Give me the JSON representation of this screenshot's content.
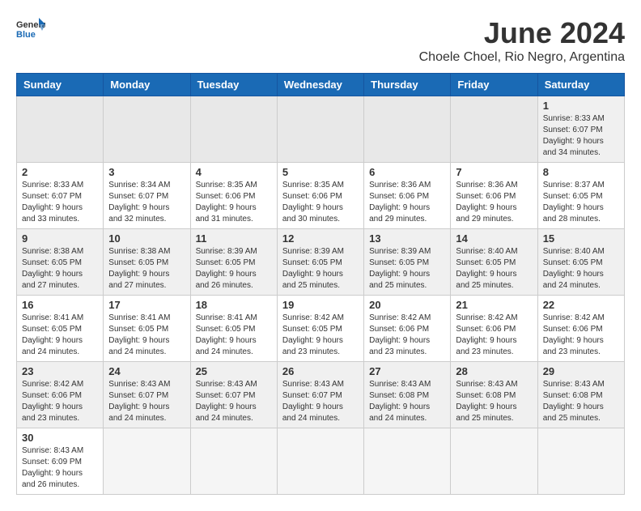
{
  "header": {
    "logo_general": "General",
    "logo_blue": "Blue",
    "title": "June 2024",
    "subtitle": "Choele Choel, Rio Negro, Argentina"
  },
  "weekdays": [
    "Sunday",
    "Monday",
    "Tuesday",
    "Wednesday",
    "Thursday",
    "Friday",
    "Saturday"
  ],
  "weeks": [
    [
      {
        "day": "",
        "info": "",
        "empty": true
      },
      {
        "day": "",
        "info": "",
        "empty": true
      },
      {
        "day": "",
        "info": "",
        "empty": true
      },
      {
        "day": "",
        "info": "",
        "empty": true
      },
      {
        "day": "",
        "info": "",
        "empty": true
      },
      {
        "day": "",
        "info": "",
        "empty": true
      },
      {
        "day": "1",
        "info": "Sunrise: 8:33 AM\nSunset: 6:07 PM\nDaylight: 9 hours\nand 34 minutes."
      }
    ],
    [
      {
        "day": "2",
        "info": "Sunrise: 8:33 AM\nSunset: 6:07 PM\nDaylight: 9 hours\nand 33 minutes."
      },
      {
        "day": "3",
        "info": "Sunrise: 8:34 AM\nSunset: 6:07 PM\nDaylight: 9 hours\nand 32 minutes."
      },
      {
        "day": "4",
        "info": "Sunrise: 8:35 AM\nSunset: 6:06 PM\nDaylight: 9 hours\nand 31 minutes."
      },
      {
        "day": "5",
        "info": "Sunrise: 8:35 AM\nSunset: 6:06 PM\nDaylight: 9 hours\nand 30 minutes."
      },
      {
        "day": "6",
        "info": "Sunrise: 8:36 AM\nSunset: 6:06 PM\nDaylight: 9 hours\nand 29 minutes."
      },
      {
        "day": "7",
        "info": "Sunrise: 8:36 AM\nSunset: 6:06 PM\nDaylight: 9 hours\nand 29 minutes."
      },
      {
        "day": "8",
        "info": "Sunrise: 8:37 AM\nSunset: 6:05 PM\nDaylight: 9 hours\nand 28 minutes."
      }
    ],
    [
      {
        "day": "9",
        "info": "Sunrise: 8:38 AM\nSunset: 6:05 PM\nDaylight: 9 hours\nand 27 minutes."
      },
      {
        "day": "10",
        "info": "Sunrise: 8:38 AM\nSunset: 6:05 PM\nDaylight: 9 hours\nand 27 minutes."
      },
      {
        "day": "11",
        "info": "Sunrise: 8:39 AM\nSunset: 6:05 PM\nDaylight: 9 hours\nand 26 minutes."
      },
      {
        "day": "12",
        "info": "Sunrise: 8:39 AM\nSunset: 6:05 PM\nDaylight: 9 hours\nand 25 minutes."
      },
      {
        "day": "13",
        "info": "Sunrise: 8:39 AM\nSunset: 6:05 PM\nDaylight: 9 hours\nand 25 minutes."
      },
      {
        "day": "14",
        "info": "Sunrise: 8:40 AM\nSunset: 6:05 PM\nDaylight: 9 hours\nand 25 minutes."
      },
      {
        "day": "15",
        "info": "Sunrise: 8:40 AM\nSunset: 6:05 PM\nDaylight: 9 hours\nand 24 minutes."
      }
    ],
    [
      {
        "day": "16",
        "info": "Sunrise: 8:41 AM\nSunset: 6:05 PM\nDaylight: 9 hours\nand 24 minutes."
      },
      {
        "day": "17",
        "info": "Sunrise: 8:41 AM\nSunset: 6:05 PM\nDaylight: 9 hours\nand 24 minutes."
      },
      {
        "day": "18",
        "info": "Sunrise: 8:41 AM\nSunset: 6:05 PM\nDaylight: 9 hours\nand 24 minutes."
      },
      {
        "day": "19",
        "info": "Sunrise: 8:42 AM\nSunset: 6:05 PM\nDaylight: 9 hours\nand 23 minutes."
      },
      {
        "day": "20",
        "info": "Sunrise: 8:42 AM\nSunset: 6:06 PM\nDaylight: 9 hours\nand 23 minutes."
      },
      {
        "day": "21",
        "info": "Sunrise: 8:42 AM\nSunset: 6:06 PM\nDaylight: 9 hours\nand 23 minutes."
      },
      {
        "day": "22",
        "info": "Sunrise: 8:42 AM\nSunset: 6:06 PM\nDaylight: 9 hours\nand 23 minutes."
      }
    ],
    [
      {
        "day": "23",
        "info": "Sunrise: 8:42 AM\nSunset: 6:06 PM\nDaylight: 9 hours\nand 23 minutes."
      },
      {
        "day": "24",
        "info": "Sunrise: 8:43 AM\nSunset: 6:07 PM\nDaylight: 9 hours\nand 24 minutes."
      },
      {
        "day": "25",
        "info": "Sunrise: 8:43 AM\nSunset: 6:07 PM\nDaylight: 9 hours\nand 24 minutes."
      },
      {
        "day": "26",
        "info": "Sunrise: 8:43 AM\nSunset: 6:07 PM\nDaylight: 9 hours\nand 24 minutes."
      },
      {
        "day": "27",
        "info": "Sunrise: 8:43 AM\nSunset: 6:08 PM\nDaylight: 9 hours\nand 24 minutes."
      },
      {
        "day": "28",
        "info": "Sunrise: 8:43 AM\nSunset: 6:08 PM\nDaylight: 9 hours\nand 25 minutes."
      },
      {
        "day": "29",
        "info": "Sunrise: 8:43 AM\nSunset: 6:08 PM\nDaylight: 9 hours\nand 25 minutes."
      }
    ],
    [
      {
        "day": "30",
        "info": "Sunrise: 8:43 AM\nSunset: 6:09 PM\nDaylight: 9 hours\nand 26 minutes."
      },
      {
        "day": "",
        "info": "",
        "empty": true
      },
      {
        "day": "",
        "info": "",
        "empty": true
      },
      {
        "day": "",
        "info": "",
        "empty": true
      },
      {
        "day": "",
        "info": "",
        "empty": true
      },
      {
        "day": "",
        "info": "",
        "empty": true
      },
      {
        "day": "",
        "info": "",
        "empty": true
      }
    ]
  ]
}
